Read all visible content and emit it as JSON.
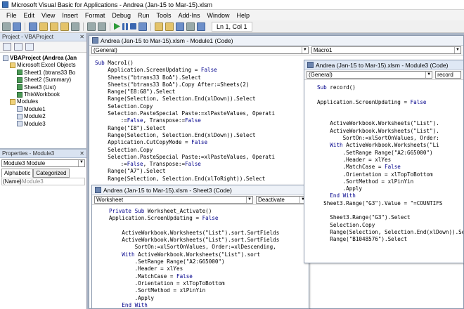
{
  "app": {
    "title": "Microsoft Visual Basic for Applications - Andrea (Jan-15 to Mar-15).xlsm"
  },
  "menu": [
    "File",
    "Edit",
    "View",
    "Insert",
    "Format",
    "Debug",
    "Run",
    "Tools",
    "Add-Ins",
    "Window",
    "Help"
  ],
  "toolbar": {
    "position": "Ln 1, Col 1"
  },
  "project_panel": {
    "title": "Project - VBAProject",
    "tree": [
      {
        "label": "VBAProject (Andrea (Jan",
        "indent": 0,
        "icon": "project-icon",
        "bold": true
      },
      {
        "label": "Microsoft Excel Objects",
        "indent": 1,
        "icon": "folder-icon"
      },
      {
        "label": "Sheet1 (btrans33 Bo",
        "indent": 2,
        "icon": "worksheet-icon"
      },
      {
        "label": "Sheet2 (Summary)",
        "indent": 2,
        "icon": "worksheet-icon"
      },
      {
        "label": "Sheet3 (List)",
        "indent": 2,
        "icon": "worksheet-icon"
      },
      {
        "label": "ThisWorkbook",
        "indent": 2,
        "icon": "workbook-icon"
      },
      {
        "label": "Modules",
        "indent": 1,
        "icon": "folder-icon"
      },
      {
        "label": "Module1",
        "indent": 2,
        "icon": "module-icon"
      },
      {
        "label": "Module2",
        "indent": 2,
        "icon": "module-icon"
      },
      {
        "label": "Module3",
        "indent": 2,
        "icon": "module-icon"
      }
    ]
  },
  "properties_panel": {
    "title": "Properties - Module3",
    "object_select": "Module3 Module",
    "tabs": [
      "Alphabetic",
      "Categorized"
    ],
    "rows": [
      {
        "key": "(Name)",
        "value": "Module3"
      }
    ]
  },
  "module1_window": {
    "title": "Andrea (Jan-15 to Mar-15).xlsm - Module1 (Code)",
    "object_combo": "(General)",
    "proc_combo": "Macro1",
    "code": [
      "Sub Macro1()",
      "    Application.ScreenUpdating = False",
      "    Sheets(\"btrans33 BoA\").Select",
      "    Sheets(\"btrans33 BoA\").Copy After:=Sheets(2)",
      "    Range(\"E8:G8\").Select",
      "    Range(Selection, Selection.End(xlDown)).Select",
      "    Selection.Copy",
      "    Selection.PasteSpecial Paste:=xlPasteValues, Operati",
      "        :=False, Transpose:=False",
      "    Range(\"I8\").Select",
      "    Range(Selection, Selection.End(xlDown)).Select",
      "    Application.CutCopyMode = False",
      "    Selection.Copy",
      "    Selection.PasteSpecial Paste:=xlPasteValues, Operati",
      "        :=False, Transpose:=False",
      "    Range(\"A7\").Select",
      "    Range(Selection, Selection.End(xlToRight)).Select"
    ]
  },
  "module3_window": {
    "title": "Andrea (Jan-15 to Mar-15).xlsm - Module3 (Code)",
    "object_combo": "(General)",
    "proc_combo": "record",
    "code": [
      "Sub record()",
      "",
      "Application.ScreenUpdating = False",
      "",
      "",
      "    ActiveWorkbook.Worksheets(\"List\").",
      "    ActiveWorkbook.Worksheets(\"List\").",
      "        SortOn:=xlSortOnValues, Order:",
      "    With ActiveWorkbook.Worksheets(\"Li",
      "        .SetRange Range(\"A2:G65000\")",
      "        .Header = xlYes",
      "        .MatchCase = False",
      "        .Orientation = xlTopToBottom",
      "        .SortMethod = xlPinYin",
      "        .Apply",
      "    End With",
      "  Sheet3.Range(\"G3\").Value = \"=COUNTIFS",
      "",
      "    Sheet3.Range(\"G3\").Select",
      "    Selection.Copy",
      "    Range(Selection, Selection.End(xlDown)).Select",
      "    Range(\"B1048576\").Select"
    ]
  },
  "sheet3_window": {
    "title": "Andrea (Jan-15 to Mar-15).xlsm - Sheet3 (Code)",
    "object_combo": "Worksheet",
    "proc_combo": "Deactivate",
    "code": [
      "Private Sub Worksheet_Activate()",
      "Application.ScreenUpdating = False",
      "",
      "    ActiveWorkbook.Worksheets(\"List\").sort.SortFields",
      "    ActiveWorkbook.Worksheets(\"List\").sort.SortFields",
      "        SortOn:=xlSortOnValues, Order:=xlDescending,",
      "    With ActiveWorkbook.Worksheets(\"List\").sort",
      "        .SetRange Range(\"A2:G65000\")",
      "        .Header = xlYes",
      "        .MatchCase = False",
      "        .Orientation = xlTopToBottom",
      "        .SortMethod = xlPinYin",
      "        .Apply",
      "    End With"
    ]
  }
}
